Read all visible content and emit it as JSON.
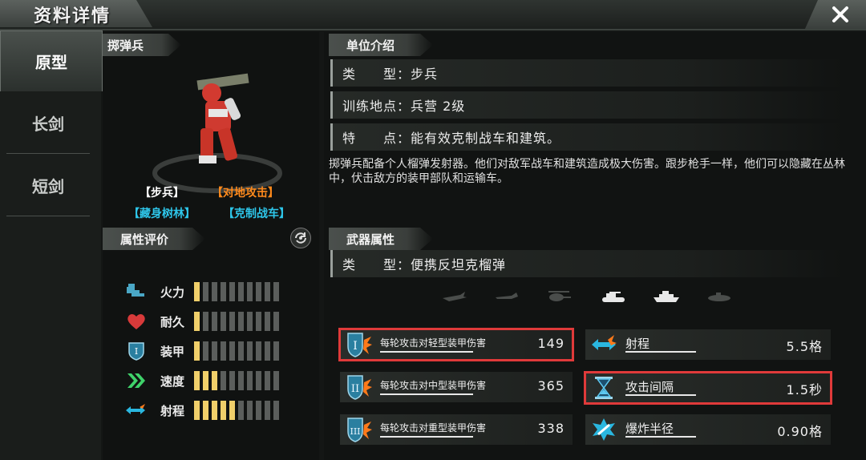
{
  "window": {
    "title": "资料详情",
    "close_icon": "close-icon"
  },
  "tabs": [
    {
      "label": "原型",
      "active": true
    },
    {
      "label": "长剑",
      "active": false
    },
    {
      "label": "短剑",
      "active": false
    }
  ],
  "unit": {
    "name": "掷弹兵",
    "tags": {
      "type": "【步兵】",
      "role": "【对地攻击】",
      "skill1": "【藏身树林】",
      "skill2": "【克制战车】"
    }
  },
  "ratings": {
    "header": "属性评价",
    "refresh_icon": "refresh-icon",
    "items": [
      {
        "label": "火力",
        "icon": "firepower-icon",
        "level": 1,
        "max": 10
      },
      {
        "label": "耐久",
        "icon": "heart-icon",
        "level": 1,
        "max": 10
      },
      {
        "label": "装甲",
        "icon": "shield-icon",
        "level": 1,
        "max": 10
      },
      {
        "label": "速度",
        "icon": "chevron-speed-icon",
        "level": 3,
        "max": 10
      },
      {
        "label": "射程",
        "icon": "range-arrows-icon",
        "level": 5,
        "max": 10
      }
    ]
  },
  "intro": {
    "header": "单位介绍",
    "type_line": "类　　型：步兵",
    "training_line": "训练地点：兵营 2级",
    "feature_line": "特　　点：能有效克制战车和建筑。",
    "description": "掷弹兵配备个人榴弹发射器。他们对敌军战车和建筑造成极大伤害。跟步枪手一样，他们可以隐藏在丛林中，伏击敌方的装甲部队和运输车。"
  },
  "weapon": {
    "header": "武器属性",
    "type_line": "类　　型：便携反坦克榴弹",
    "target_types": [
      "plane-icon",
      "jet-icon",
      "helicopter-icon",
      "tank-icon",
      "ship-icon",
      "submarine-icon"
    ],
    "active_targets": [
      "tank-icon",
      "ship-icon"
    ],
    "stats_left": [
      {
        "label": "每轮攻击对轻型装甲伤害",
        "value": "149",
        "icon": "armor-I-icon",
        "highlighted": true
      },
      {
        "label": "每轮攻击对中型装甲伤害",
        "value": "365",
        "icon": "armor-II-icon",
        "highlighted": false
      },
      {
        "label": "每轮攻击对重型装甲伤害",
        "value": "338",
        "icon": "armor-III-icon",
        "highlighted": false
      }
    ],
    "stats_right": [
      {
        "label": "射程",
        "value": "5.5格",
        "icon": "range-icon",
        "highlighted": false
      },
      {
        "label": "攻击间隔",
        "value": "1.5秒",
        "icon": "hourglass-icon",
        "highlighted": true
      },
      {
        "label": "爆炸半径",
        "value": "0.90格",
        "icon": "blast-icon",
        "highlighted": false
      }
    ]
  },
  "colors": {
    "bar_on": "#f0cf6a",
    "bar_off": "#5b5e5c",
    "highlight": "#e03a3a",
    "tag_orange": "#ff8a1c",
    "tag_cyan": "#2ec6ea"
  }
}
